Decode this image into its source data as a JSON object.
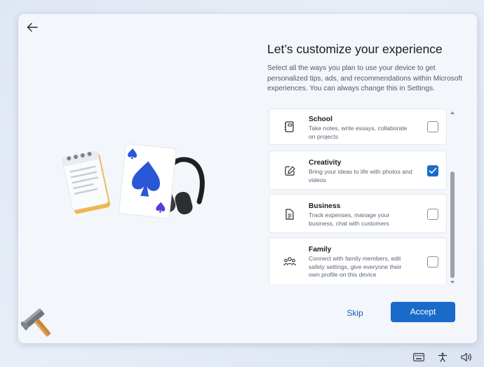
{
  "header": {
    "title": "Let’s customize your experience",
    "description": "Select all the ways you plan to use your device to get personalized tips, ads, and recommendations within Microsoft experiences. You can always change this in Settings."
  },
  "options": [
    {
      "title": "School",
      "subtitle": "Take notes, write essays, collaborate on projects",
      "checked": false,
      "icon": "notebook-icon"
    },
    {
      "title": "Creativity",
      "subtitle": "Bring your ideas to life with photos and videos",
      "checked": true,
      "icon": "pen-canvas-icon"
    },
    {
      "title": "Business",
      "subtitle": "Track expenses, manage your business, chat with customers",
      "checked": false,
      "icon": "document-icon"
    },
    {
      "title": "Family",
      "subtitle": "Connect with family members, edit safety settings, give everyone their own profile on this device",
      "checked": false,
      "icon": "people-icon"
    }
  ],
  "buttons": {
    "skip_label": "Skip",
    "accept_label": "Accept"
  },
  "colors": {
    "accent": "#1a6bc9",
    "link": "#1a5fb0",
    "window_bg": "#f3f6fb"
  },
  "tray": [
    "keyboard-icon",
    "accessibility-icon",
    "volume-icon"
  ]
}
